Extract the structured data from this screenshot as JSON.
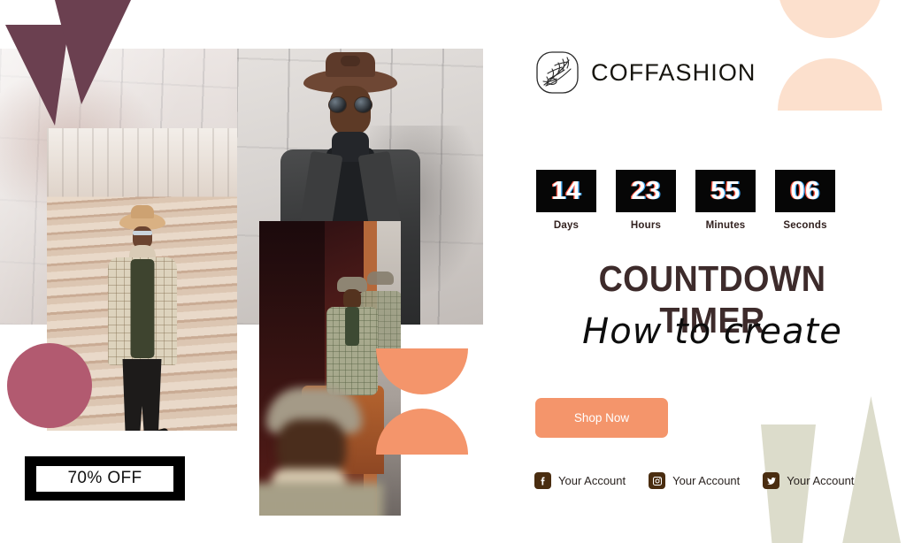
{
  "brand": {
    "name": "COFFASHION",
    "logo_icon": "wheat-sprig-logo-icon"
  },
  "promo": {
    "discount_badge": "70% OFF"
  },
  "countdown": {
    "units": [
      {
        "value": "14",
        "label": "Days"
      },
      {
        "value": "23",
        "label": "Hours"
      },
      {
        "value": "55",
        "label": "Minutes"
      },
      {
        "value": "06",
        "label": "Seconds"
      }
    ]
  },
  "headline": "COUNTDOWN TIMER",
  "subheadline": "How to create",
  "cta": {
    "label": "Shop Now"
  },
  "socials": [
    {
      "icon": "facebook-icon",
      "label": "Your Account"
    },
    {
      "icon": "instagram-icon",
      "label": "Your Account"
    },
    {
      "icon": "twitter-icon",
      "label": "Your Account"
    }
  ],
  "colors": {
    "accent_orange": "#f4956b",
    "peach": "#fce0cd",
    "plum": "#6b4050",
    "rose": "#b25a70",
    "sage": "#dcdccb",
    "headline_brown": "#3d2b2b",
    "social_icon_brown": "#4a2d10",
    "timer_box": "#060606"
  }
}
